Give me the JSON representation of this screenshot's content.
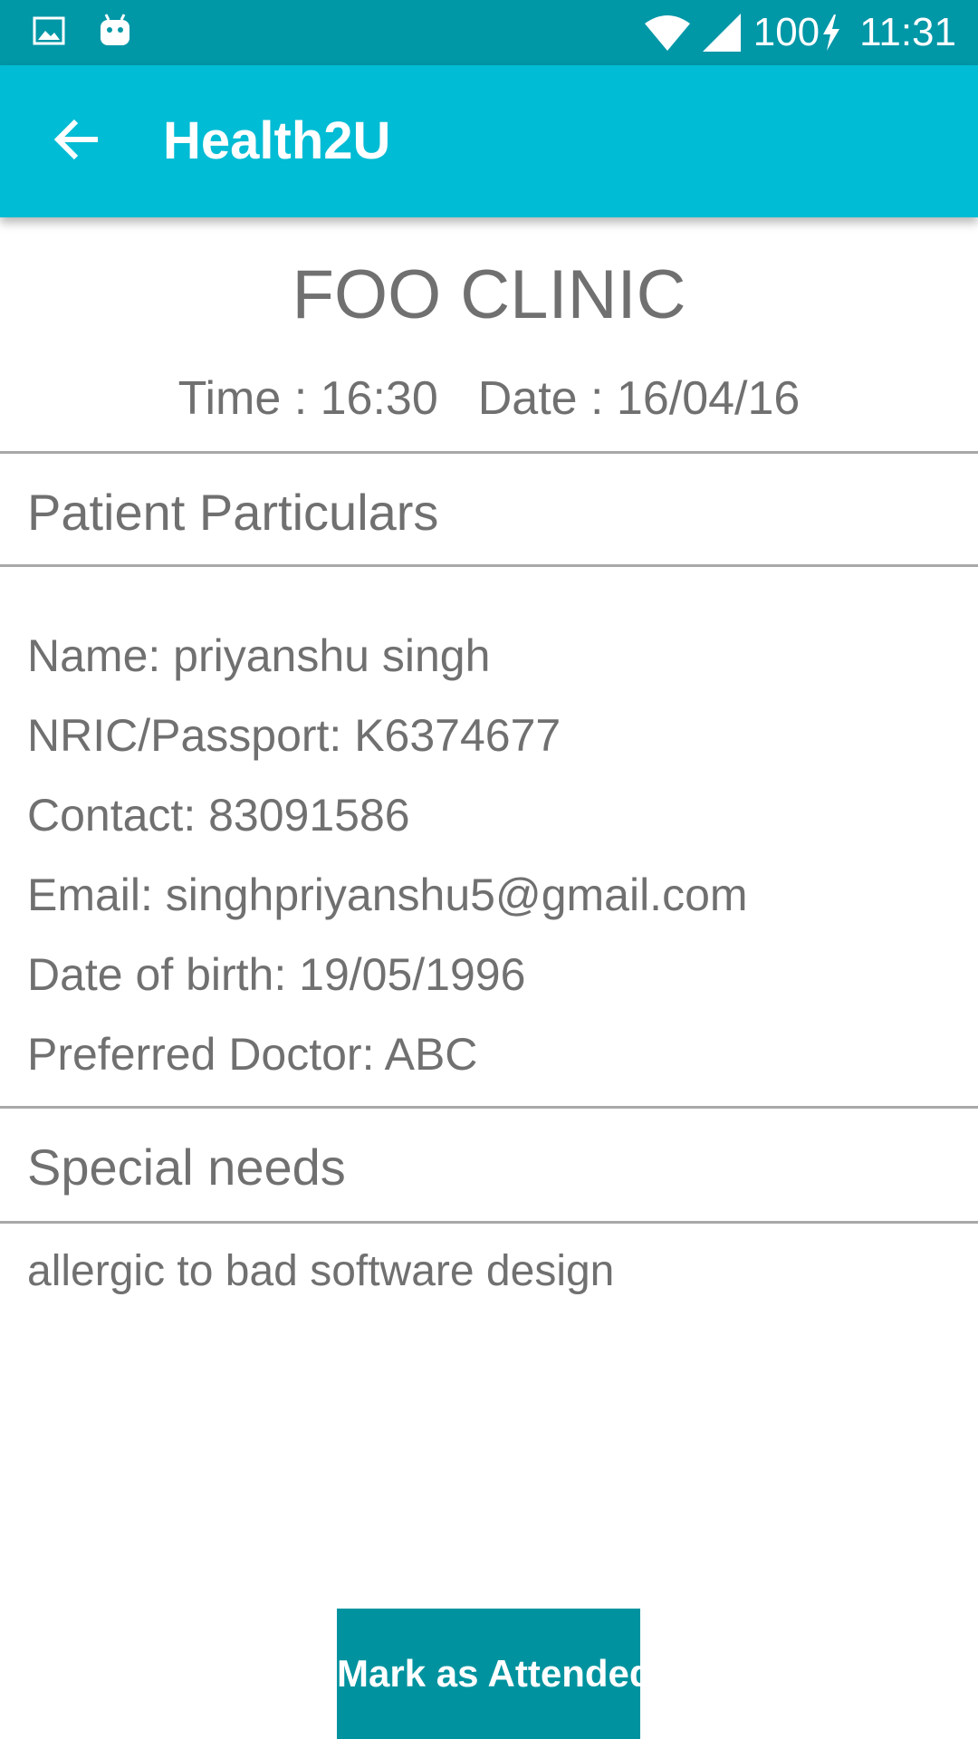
{
  "status_bar": {
    "battery": "100",
    "time": "11:31",
    "icons": [
      "image-icon",
      "android-icon",
      "wifi-icon",
      "cell-signal-icon",
      "charging-bolt-icon"
    ]
  },
  "app_bar": {
    "title": "Health2U",
    "back_icon": "arrow-back-icon"
  },
  "clinic": {
    "name": "FOO CLINIC",
    "time": "Time : 16:30",
    "date": "Date : 16/04/16"
  },
  "patient_section": {
    "title": "Patient Particulars",
    "name": "Name: priyanshu singh",
    "nric": "NRIC/Passport: K6374677",
    "contact": "Contact: 83091586",
    "email": "Email: singhpriyanshu5@gmail.com",
    "dob": "Date of birth: 19/05/1996",
    "doctor": "Preferred Doctor: ABC"
  },
  "special_needs": {
    "title": "Special needs",
    "text": "allergic to bad software design"
  },
  "actions": {
    "mark_attended": "Mark as Attended"
  },
  "colors": {
    "status_bar": "#0097a7",
    "app_bar": "#00bcd4",
    "button": "#00939f",
    "text": "#707070"
  }
}
